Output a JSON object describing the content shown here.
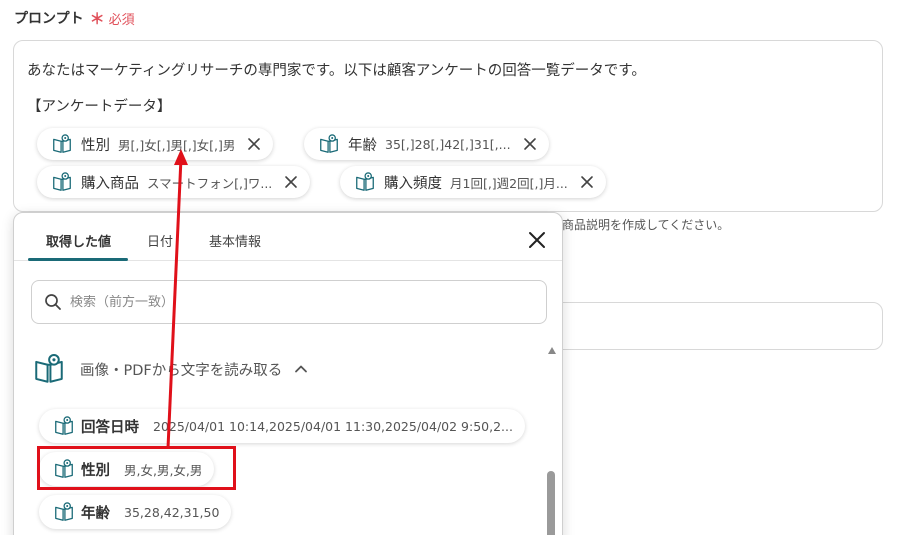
{
  "field": {
    "label": "プロンプト",
    "required_mark": "＊",
    "required_text": "必須"
  },
  "prompt": {
    "line1": "あなたはマーケティングリサーチの専門家です。以下は顧客アンケートの回答一覧データです。",
    "line2": "【アンケートデータ】",
    "chips": [
      {
        "name": "性別",
        "value": "男[,]女[,]男[,]女[,]男",
        "icon": "book-icon",
        "remove_icon": "close-icon"
      },
      {
        "name": "年齢",
        "value": "35[,]28[,]42[,]31[,...",
        "icon": "book-icon",
        "remove_icon": "close-icon"
      },
      {
        "name": "購入商品",
        "value": "スマートフォン[,]ワ...",
        "icon": "book-icon",
        "remove_icon": "close-icon"
      },
      {
        "name": "購入頻度",
        "value": "月1回[,]週2回[,]月...",
        "icon": "book-icon",
        "remove_icon": "close-icon"
      }
    ]
  },
  "hint": "商品説明を作成してください。",
  "popup": {
    "tabs": [
      {
        "label": "取得した値",
        "active": true
      },
      {
        "label": "日付",
        "active": false
      },
      {
        "label": "基本情報",
        "active": false
      }
    ],
    "close_icon": "close-icon",
    "search": {
      "icon": "search-icon",
      "placeholder": "検索（前方一致）",
      "value": ""
    },
    "section": {
      "icon": "book-icon",
      "label": "画像・PDFから文字を読み取る",
      "chevron": "chevron-up-icon"
    },
    "items": [
      {
        "name": "回答日時",
        "value": "2025/04/01 10:14,2025/04/01 11:30,2025/04/02 9:50,2..."
      },
      {
        "name": "性別",
        "value": "男,女,男,女,男"
      },
      {
        "name": "年齢",
        "value": "35,28,42,31,50"
      }
    ]
  },
  "colors": {
    "required": "#e0505a",
    "tab_active": "#1a6a77",
    "highlight": "#e0101a",
    "icon": "#1a6a77"
  }
}
